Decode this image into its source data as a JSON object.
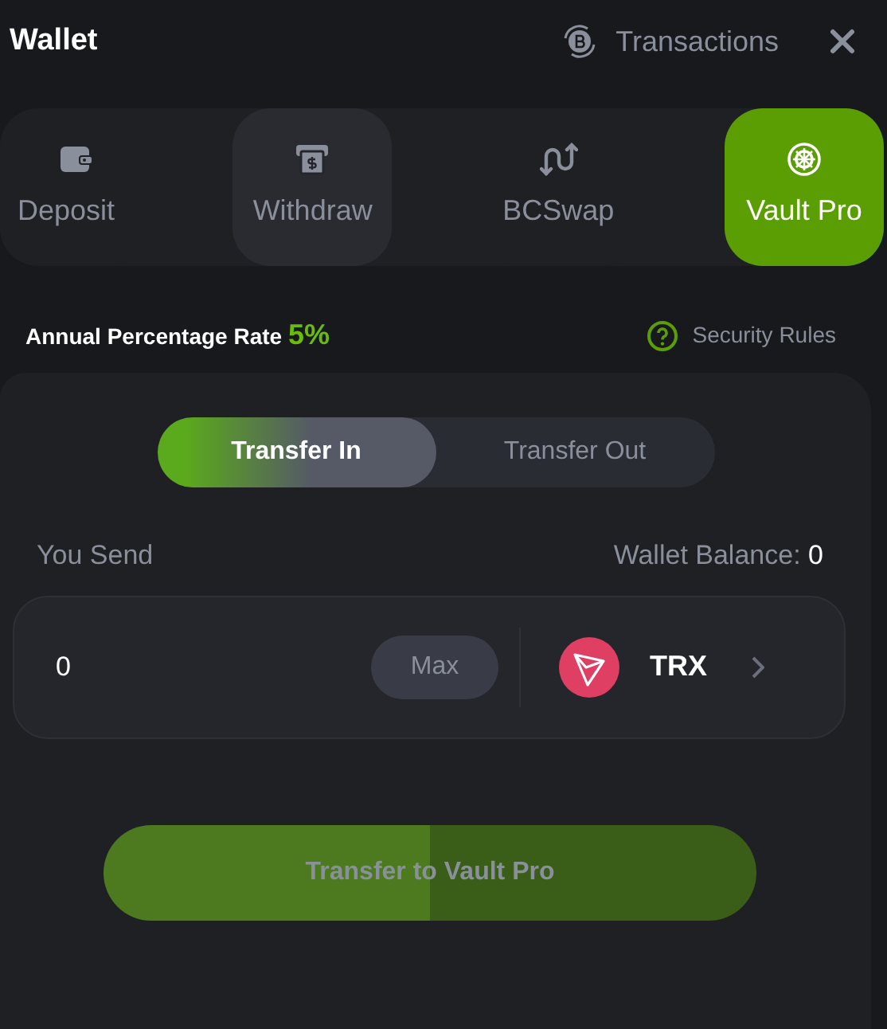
{
  "header": {
    "title": "Wallet",
    "transactions": "Transactions"
  },
  "tabs": [
    {
      "label": "Deposit",
      "selected": false,
      "hovered": false
    },
    {
      "label": "Withdraw",
      "selected": false,
      "hovered": true
    },
    {
      "label": "BCSwap",
      "selected": false,
      "hovered": false
    },
    {
      "label": "Vault Pro",
      "selected": true,
      "hovered": false
    }
  ],
  "apr": {
    "label": "Annual Percentage Rate",
    "value": "5%"
  },
  "security_rules": "Security Rules",
  "transfer_modes": [
    {
      "label": "Transfer In",
      "selected": true
    },
    {
      "label": "Transfer Out",
      "selected": false
    }
  ],
  "send": {
    "label": "You Send",
    "balance_label": "Wallet Balance:",
    "balance": "0",
    "amount": "0",
    "max": "Max",
    "currency": "TRX"
  },
  "submit": {
    "label": "Transfer to Vault Pro",
    "disabled": true
  }
}
